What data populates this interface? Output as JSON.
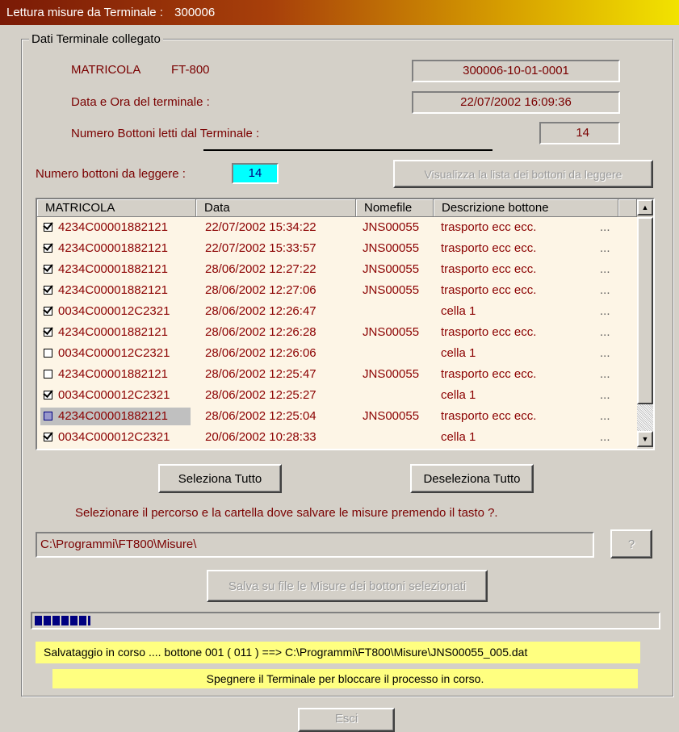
{
  "window": {
    "title_label": "Lettura misure da Terminale  :",
    "title_value": "300006"
  },
  "group": {
    "legend": "Dati Terminale collegato"
  },
  "terminal": {
    "matricola_label": "MATRICOLA",
    "matricola_model": "FT-800",
    "matricola_value": "300006-10-01-0001",
    "datetime_label": "Data e Ora del terminale  :",
    "datetime_value": "22/07/2002   16:09:36",
    "buttons_read_label": "Numero Bottoni letti dal Terminale :",
    "buttons_read_value": "14"
  },
  "to_read": {
    "label": "Numero bottoni da leggere  :",
    "value": "14",
    "show_list_button": "Visualizza la lista dei bottoni da leggere"
  },
  "table": {
    "headers": [
      "MATRICOLA",
      "Data",
      "Nomefile",
      "Descrizione bottone"
    ],
    "rows": [
      {
        "checked": true,
        "selected": false,
        "matricola": "4234C00001882121",
        "data": "22/07/2002 15:34:22",
        "nomefile": "JNS00055",
        "descrizione": "trasporto ecc ecc.",
        "more": "..."
      },
      {
        "checked": true,
        "selected": false,
        "matricola": "4234C00001882121",
        "data": "22/07/2002 15:33:57",
        "nomefile": "JNS00055",
        "descrizione": "trasporto ecc ecc.",
        "more": "..."
      },
      {
        "checked": true,
        "selected": false,
        "matricola": "4234C00001882121",
        "data": "28/06/2002 12:27:22",
        "nomefile": "JNS00055",
        "descrizione": "trasporto ecc ecc.",
        "more": "..."
      },
      {
        "checked": true,
        "selected": false,
        "matricola": "4234C00001882121",
        "data": "28/06/2002 12:27:06",
        "nomefile": "JNS00055",
        "descrizione": "trasporto ecc ecc.",
        "more": "..."
      },
      {
        "checked": true,
        "selected": false,
        "matricola": "0034C000012C2321",
        "data": "28/06/2002 12:26:47",
        "nomefile": "",
        "descrizione": "cella 1",
        "more": "..."
      },
      {
        "checked": true,
        "selected": false,
        "matricola": "4234C00001882121",
        "data": "28/06/2002 12:26:28",
        "nomefile": "JNS00055",
        "descrizione": "trasporto ecc ecc.",
        "more": "..."
      },
      {
        "checked": false,
        "selected": false,
        "matricola": "0034C000012C2321",
        "data": "28/06/2002 12:26:06",
        "nomefile": "",
        "descrizione": "cella 1",
        "more": "..."
      },
      {
        "checked": false,
        "selected": false,
        "matricola": "4234C00001882121",
        "data": "28/06/2002 12:25:47",
        "nomefile": "JNS00055",
        "descrizione": "trasporto ecc ecc.",
        "more": "..."
      },
      {
        "checked": true,
        "selected": false,
        "matricola": "0034C000012C2321",
        "data": "28/06/2002 12:25:27",
        "nomefile": "",
        "descrizione": "cella 1",
        "more": "..."
      },
      {
        "checked": false,
        "selected": true,
        "matricola": "4234C00001882121",
        "data": "28/06/2002 12:25:04",
        "nomefile": "JNS00055",
        "descrizione": "trasporto ecc ecc.",
        "more": "..."
      },
      {
        "checked": true,
        "selected": false,
        "matricola": "0034C000012C2321",
        "data": "20/06/2002 10:28:33",
        "nomefile": "",
        "descrizione": "cella 1",
        "more": "..."
      }
    ]
  },
  "actions": {
    "select_all": "Seleziona Tutto",
    "deselect_all": "Deseleziona Tutto",
    "path_instruction": "Selezionare il percorso e la cartella dove salvare le misure premendo il tasto ?.",
    "path_value": "C:\\Programmi\\FT800\\Misure\\",
    "browse": "?",
    "save_button": "Salva su file le Misure dei bottoni selezionati"
  },
  "progress": {
    "fraction": 0.09,
    "color": "#000080"
  },
  "status": {
    "saving": "Salvataggio in corso .... bottone   001 ( 011 ) ==> C:\\Programmi\\FT800\\Misure\\JNS00055_005.dat",
    "warning": "Spegnere il Terminale per bloccare il processo in corso."
  },
  "footer": {
    "exit_button": "Esci"
  },
  "colors": {
    "accent_cyan": "#00ffff",
    "label_red": "#7a0000",
    "status_yellow": "#ffff80",
    "table_bg": "#fdf5e6"
  }
}
